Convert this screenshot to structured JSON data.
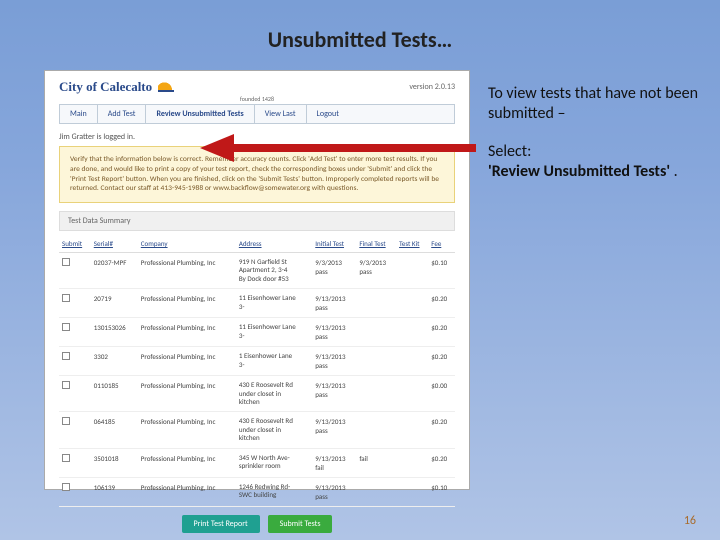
{
  "slide": {
    "title": "Unsubmitted Tests…",
    "page_number": "16"
  },
  "side": {
    "p1": "To view tests that have not been submitted –",
    "p2a": "Select:",
    "p2b": "'Review Unsubmitted Tests'",
    "p2c": " ."
  },
  "app": {
    "city": "City of Calecalto",
    "founded": "founded 1428",
    "version": "version 2.0.13",
    "nav": {
      "main": "Main",
      "add": "Add Test",
      "review": "Review Unsubmitted Tests",
      "last": "View Last",
      "logout": "Logout"
    },
    "logged_in": "Jim Gratter is logged in.",
    "notice": "Verify that the information below is correct. Remember accuracy counts. Click 'Add Test' to enter more test results. If you are done, and would like to print a copy of your test report, check the corresponding boxes under 'Submit' and click the 'Print Test Report' button. When you are finished, click on the 'Submit Tests' button. Improperly completed reports will be returned. Contact our staff at 413-945-1988 or www.backflow@somewater.org with questions.",
    "section_title": "Test Data Summary",
    "columns": {
      "submit": "Submit",
      "serial": "Serial#",
      "company": "Company",
      "address": "Address",
      "initial": "Initial Test",
      "final": "Final Test",
      "kit": "Test Kit",
      "fee": "Fee"
    },
    "rows": [
      {
        "serial": "02037-MPF",
        "company": "Professional Plumbing, Inc",
        "address": "919 N Garfield St\nApartment 2, 3-4\nBy Dock door #53",
        "initial_date": "9/3/2013",
        "initial_res": "pass",
        "final_date": "9/3/2013",
        "final_res": "pass",
        "fee": "$0.10"
      },
      {
        "serial": "20719",
        "company": "Professional Plumbing, Inc",
        "address": "11 Eisenhower Lane\n3-",
        "initial_date": "9/13/2013",
        "initial_res": "pass",
        "final_date": "",
        "final_res": "",
        "fee": "$0.20"
      },
      {
        "serial": "130153026",
        "company": "Professional Plumbing, Inc",
        "address": "11 Eisenhower Lane\n3-",
        "initial_date": "9/13/2013",
        "initial_res": "pass",
        "final_date": "",
        "final_res": "",
        "fee": "$0.20"
      },
      {
        "serial": "3302",
        "company": "Professional Plumbing, Inc",
        "address": "1 Eisenhower Lane\n3-",
        "initial_date": "9/13/2013",
        "initial_res": "pass",
        "final_date": "",
        "final_res": "",
        "fee": "$0.20"
      },
      {
        "serial": "0110185",
        "company": "Professional Plumbing, Inc",
        "address": "430 E Roosevelt Rd\nunder closet in\nkitchen",
        "initial_date": "9/13/2013",
        "initial_res": "pass",
        "final_date": "",
        "final_res": "",
        "fee": "$0.00"
      },
      {
        "serial": "064185",
        "company": "Professional Plumbing, Inc",
        "address": "430 E Roosevelt Rd\nunder closet in\nkitchen",
        "initial_date": "9/13/2013",
        "initial_res": "pass",
        "final_date": "",
        "final_res": "",
        "fee": "$0.20"
      },
      {
        "serial": "3501018",
        "company": "Professional Plumbing, Inc",
        "address": "345 W North Ave-\nsprinkler room",
        "initial_date": "9/13/2013",
        "initial_res": "fail",
        "final_date": "",
        "final_res": "fail",
        "fee": "$0.20"
      },
      {
        "serial": "106139",
        "company": "Professional Plumbing, Inc",
        "address": "1246 Redwing Rd-\nSWC building",
        "initial_date": "9/13/2013",
        "initial_res": "pass",
        "final_date": "",
        "final_res": "",
        "fee": "$0.10"
      }
    ],
    "buttons": {
      "print": "Print Test Report",
      "submit": "Submit Tests"
    }
  }
}
